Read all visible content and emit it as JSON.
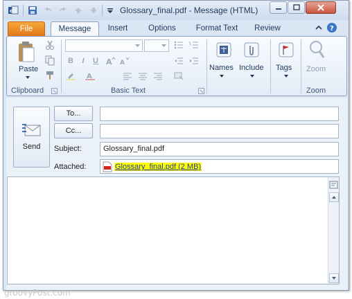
{
  "window": {
    "title": "Glossary_final.pdf - Message (HTML)"
  },
  "quick_access": {
    "icons": [
      "outlook-icon",
      "save-icon",
      "undo-icon",
      "redo-icon",
      "previous-icon",
      "next-icon",
      "customize-icon"
    ]
  },
  "tabs": [
    {
      "label": "File",
      "selected": false
    },
    {
      "label": "Message",
      "selected": true
    },
    {
      "label": "Insert",
      "selected": false
    },
    {
      "label": "Options",
      "selected": false
    },
    {
      "label": "Format Text",
      "selected": false
    },
    {
      "label": "Review",
      "selected": false
    }
  ],
  "ribbon": {
    "clipboard": {
      "paste_label": "Paste",
      "group_label": "Clipboard"
    },
    "basic_text": {
      "group_label": "Basic Text",
      "bold": "B",
      "italic": "I",
      "underline": "U"
    },
    "names_label": "Names",
    "include_label": "Include",
    "tags_label": "Tags",
    "zoom": {
      "button_label": "Zoom",
      "group_label": "Zoom"
    }
  },
  "compose": {
    "send_label": "Send",
    "to_button": "To...",
    "cc_button": "Cc...",
    "to_value": "",
    "cc_value": "",
    "subject_label": "Subject:",
    "subject_value": "Glossary_final.pdf",
    "attached_label": "Attached:",
    "attachment": "Glossary_final.pdf (2 MB)",
    "body_text": ""
  },
  "watermark": "groovyPost.com",
  "colors": {
    "file_tab": "#e2741a",
    "attachment_highlight": "#ffff00",
    "link": "#1f3aa6"
  }
}
